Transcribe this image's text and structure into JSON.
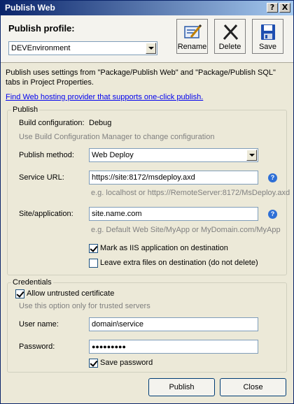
{
  "window": {
    "title": "Publish Web"
  },
  "title_buttons": {
    "help": "?",
    "close": "X"
  },
  "profile": {
    "label": "Publish profile:",
    "selected": "DEVEnvironment"
  },
  "toolbar": {
    "rename_label": "Rename",
    "delete_label": "Delete",
    "save_label": "Save"
  },
  "description": "Publish uses settings from \"Package/Publish Web\" and \"Package/Publish SQL\" tabs in Project Properties.",
  "hosting_link": "Find Web hosting provider that supports one-click publish.",
  "publish_group": {
    "legend": "Publish",
    "build_config_label": "Build configuration:",
    "build_config_value": "Debug",
    "build_config_hint": "Use Build Configuration Manager to change configuration",
    "method_label": "Publish method:",
    "method_value": "Web Deploy",
    "service_url_label": "Service URL:",
    "service_url_value": "https://site:8172/msdeploy.axd",
    "service_url_hint": "e.g. localhost or https://RemoteServer:8172/MsDeploy.axd",
    "site_label": "Site/application:",
    "site_value": "site.name.com",
    "site_hint": "e.g. Default Web Site/MyApp or MyDomain.com/MyApp",
    "mark_iis_label": "Mark as IIS application on destination",
    "mark_iis_checked": true,
    "leave_extra_label": "Leave extra files on destination (do not delete)",
    "leave_extra_checked": false
  },
  "credentials_group": {
    "legend": "Credentials",
    "allow_untrusted_label": "Allow untrusted certificate",
    "allow_untrusted_checked": true,
    "allow_untrusted_hint": "Use this option only for trusted servers",
    "username_label": "User name:",
    "username_value": "domain\\service",
    "password_label": "Password:",
    "password_value": "●●●●●●●●●",
    "save_password_label": "Save password",
    "save_password_checked": true
  },
  "footer": {
    "publish_label": "Publish",
    "close_label": "Close"
  },
  "icons": [
    "rename-icon",
    "delete-icon",
    "save-icon",
    "help-icon",
    "dropdown-arrow-icon",
    "checkbox-check-icon"
  ]
}
